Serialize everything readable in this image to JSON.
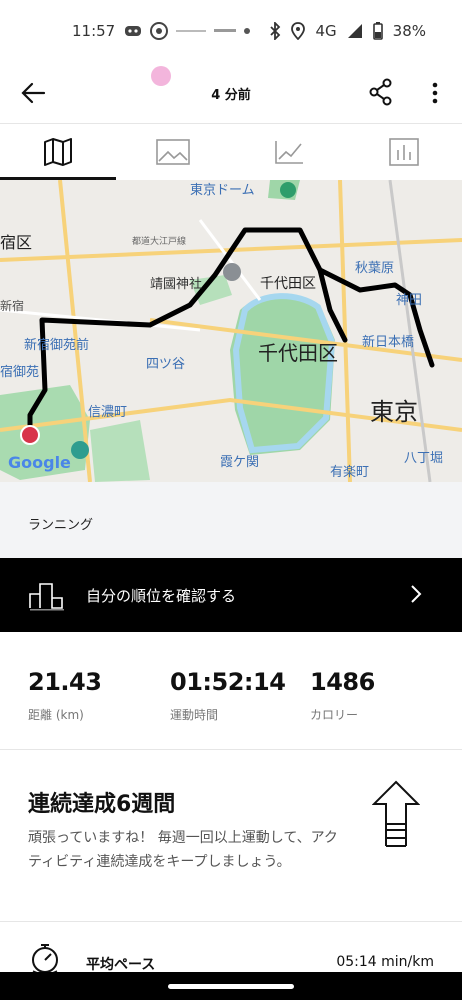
{
  "status": {
    "time": "11:57",
    "network": "4G",
    "battery": "38%",
    "icons": [
      "discord-icon",
      "wifi-hotspot-icon",
      "weather-icon",
      "app-icon",
      "bluetooth-icon",
      "location-icon",
      "signal-icon",
      "battery-icon"
    ]
  },
  "header": {
    "title": "4 分前",
    "back_icon": "arrow-left-icon",
    "share_icon": "share-icon",
    "more_icon": "more-vert-icon"
  },
  "tabs": [
    {
      "name": "map",
      "icon": "map-icon",
      "active": true
    },
    {
      "name": "photo",
      "icon": "image-icon",
      "active": false
    },
    {
      "name": "graph",
      "icon": "line-chart-icon",
      "active": false
    },
    {
      "name": "splits",
      "icon": "bar-chart-icon",
      "active": false
    }
  ],
  "map": {
    "labels": {
      "tokyo_dome": "東京ドーム",
      "yasukuni": "靖國神社",
      "chiyoda_ku_small": "千代田区",
      "chiyoda_ku": "千代田区",
      "akihabara": "秋葉原",
      "kanda": "神田",
      "shin_nihombashi": "新日本橋",
      "tokyo": "東京",
      "yotsuya": "四ツ谷",
      "shinanomachi": "信濃町",
      "shinjuku_gyoen": "新宿御苑前",
      "shinjuku_gyoen2": "宿御苑",
      "shinjuku_ku": "宿区",
      "shinjuku": "新宿",
      "kasumigaseki": "霞ケ関",
      "yurakucho": "有楽町",
      "hatchobori": "八丁堀",
      "road_label": "都道大江戸線"
    },
    "attribution": "Google"
  },
  "activity": {
    "type_label": "ランニング"
  },
  "rank": {
    "label": "自分の順位を確認する"
  },
  "stats": [
    {
      "value": "21.43",
      "label": "距離 (km)"
    },
    {
      "value": "01:52:14",
      "label": "運動時間"
    },
    {
      "value": "1486",
      "label": "カロリー"
    }
  ],
  "streak": {
    "title": "連続達成6週間",
    "description": "頑張っていますね！ 毎週一回以上運動して、アクティビティ連続達成をキープしましょう。"
  },
  "pace": {
    "label": "平均ペース",
    "value": "05:14 min/km"
  },
  "colors": {
    "accent": "#000000",
    "map_green": "#9fd6a8",
    "map_water": "#a6d7ef",
    "map_road": "#f7c95a",
    "route": "#000000",
    "start_marker": "#d8334a",
    "pink_dot": "#f3b5dc"
  }
}
